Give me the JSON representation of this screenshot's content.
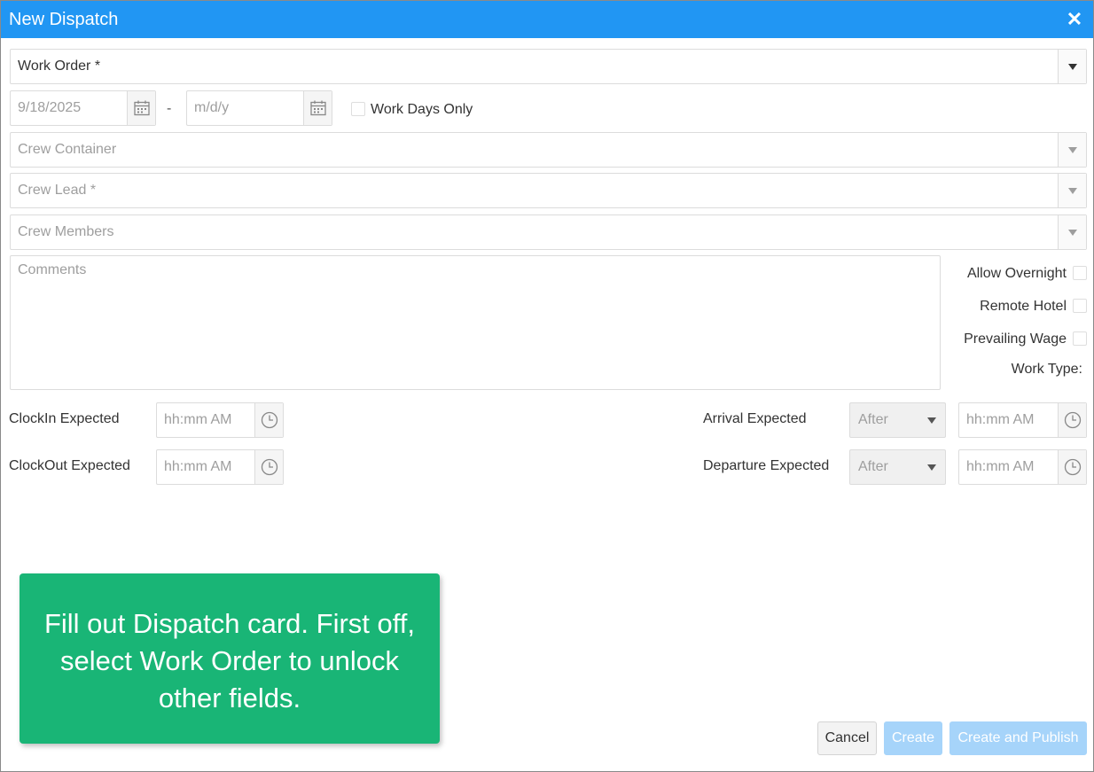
{
  "dialog": {
    "title": "New Dispatch",
    "close_icon": "close-icon"
  },
  "form": {
    "work_order": {
      "placeholder": "Work Order *"
    },
    "start_date": {
      "value": "9/18/2025"
    },
    "date_separator": "-",
    "end_date": {
      "placeholder": "m/d/y"
    },
    "work_days_only": {
      "label": "Work Days Only",
      "checked": false
    },
    "crew_container": {
      "placeholder": "Crew Container"
    },
    "crew_lead": {
      "placeholder": "Crew Lead *"
    },
    "crew_members": {
      "placeholder": "Crew Members"
    },
    "comments": {
      "placeholder": "Comments"
    },
    "allow_overnight": {
      "label": "Allow Overnight",
      "checked": false
    },
    "remote_hotel": {
      "label": "Remote Hotel",
      "checked": false
    },
    "prevailing_wage": {
      "label": "Prevailing Wage",
      "checked": false
    },
    "work_type": {
      "label": "Work Type:"
    },
    "clockin": {
      "label": "ClockIn Expected",
      "placeholder": "hh:mm AM"
    },
    "clockout": {
      "label": "ClockOut Expected",
      "placeholder": "hh:mm AM"
    },
    "arrival": {
      "label": "Arrival Expected",
      "mode": "After",
      "placeholder": "hh:mm AM"
    },
    "departure": {
      "label": "Departure Expected",
      "mode": "After",
      "placeholder": "hh:mm AM"
    }
  },
  "buttons": {
    "cancel": "Cancel",
    "create": "Create",
    "create_publish": "Create and Publish"
  },
  "tooltip": {
    "text": "Fill out Dispatch card. First off, select Work Order to unlock other fields."
  },
  "colors": {
    "titlebar": "#2196f3",
    "tooltip": "#19b576",
    "primary_disabled": "#a6d4fa"
  }
}
